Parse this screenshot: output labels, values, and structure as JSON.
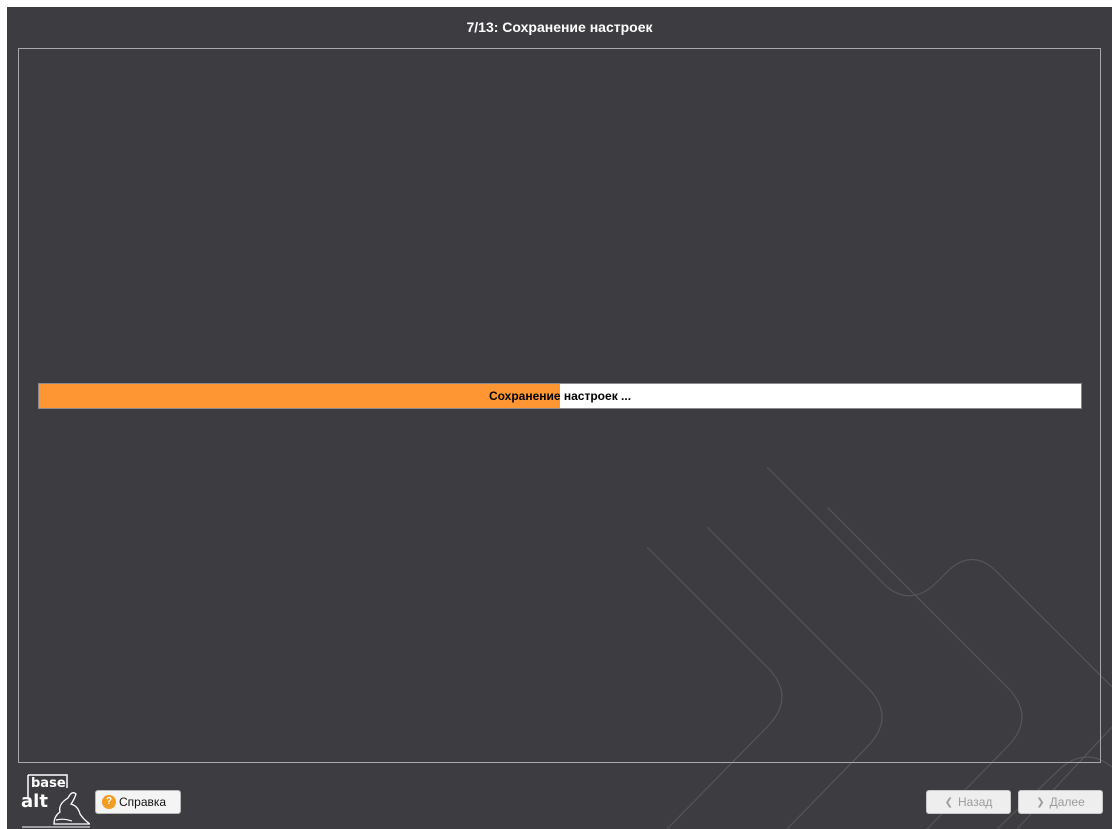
{
  "window": {
    "title": "7/13: Сохранение настроек"
  },
  "progress": {
    "label": "Сохранение настроек ...",
    "fraction": 0.5
  },
  "footer": {
    "logo_top": "base",
    "logo_bottom": "alt",
    "help_label": "Справка",
    "help_icon": "question-icon",
    "back_label": "Назад",
    "back_icon": "chevron-left-icon",
    "next_label": "Далее",
    "next_icon": "chevron-right-icon"
  },
  "colors": {
    "background": "#3d3c41",
    "progress_fill": "#fd9633",
    "help_icon": "#f39c23"
  }
}
